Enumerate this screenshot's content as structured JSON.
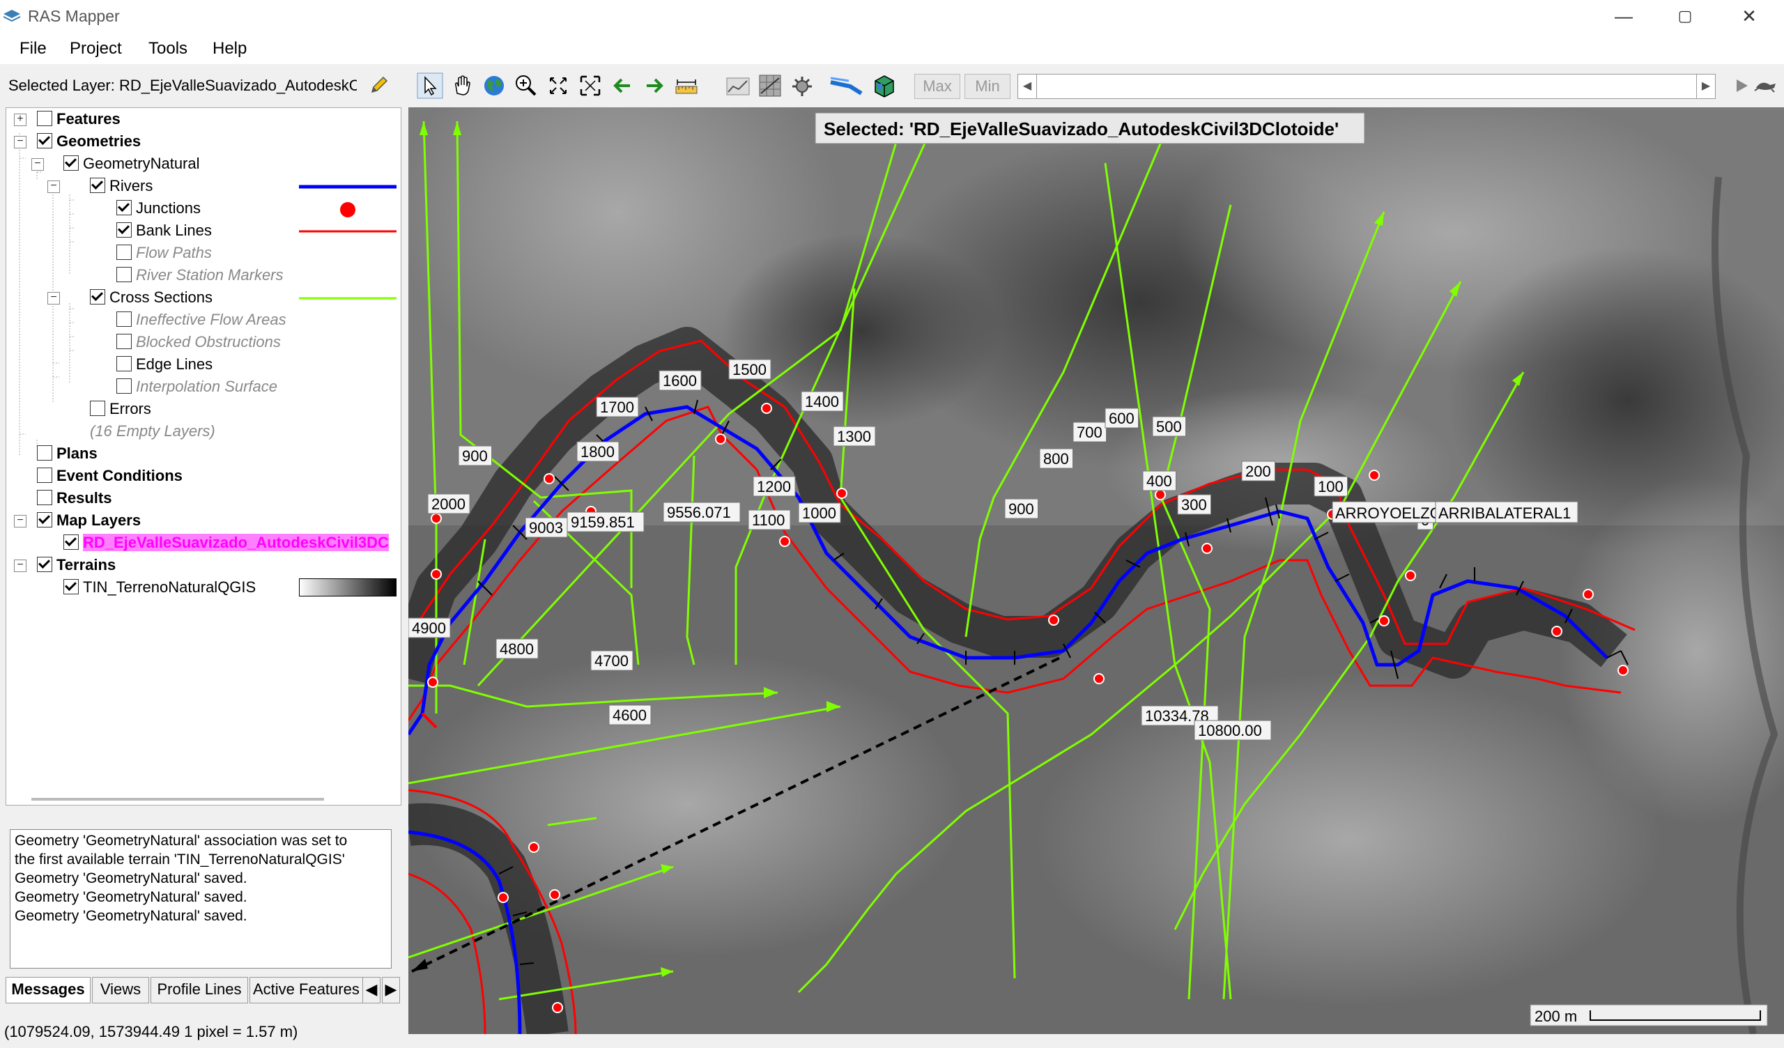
{
  "window": {
    "title": "RAS Mapper",
    "minimize": "—",
    "maximize": "▢",
    "close": "✕"
  },
  "menu": [
    "File",
    "Project",
    "Tools",
    "Help"
  ],
  "selected_layer": "Selected Layer: RD_EjeValleSuavizado_AutodeskC",
  "toolbar": {
    "max": "Max",
    "min": "Min"
  },
  "tree": {
    "features": "Features",
    "geometries": "Geometries",
    "geometry_natural": "GeometryNatural",
    "rivers": "Rivers",
    "junctions": "Junctions",
    "bank_lines": "Bank Lines",
    "flow_paths": "Flow Paths",
    "river_station_markers": "River Station Markers",
    "cross_sections": "Cross Sections",
    "ineffective": "Ineffective Flow Areas",
    "blocked": "Blocked Obstructions",
    "edge_lines": "Edge Lines",
    "interp_surface": "Interpolation Surface",
    "errors": "Errors",
    "empty_layers": "(16 Empty Layers)",
    "plans": "Plans",
    "event_conditions": "Event Conditions",
    "results": "Results",
    "map_layers": "Map Layers",
    "selected_layer_name": "RD_EjeValleSuavizado_AutodeskCivil3DC",
    "terrains": "Terrains",
    "terrain_name": "TIN_TerrenoNaturalQGIS"
  },
  "colors": {
    "river": "#0000ff",
    "junction": "#ff0000",
    "bank": "#ff0000",
    "xs": "#80ff00",
    "highlight": "#ff00ff"
  },
  "messages": [
    "Geometry 'GeometryNatural' association was set to",
    "the first available terrain 'TIN_TerrenoNaturalQGIS'",
    "Geometry 'GeometryNatural' saved.",
    "Geometry 'GeometryNatural' saved.",
    "Geometry 'GeometryNatural' saved."
  ],
  "tabs": [
    "Messages",
    "Views",
    "Profile Lines",
    "Active Features"
  ],
  "status": "(1079524.09, 1573944.49  1 pixel = 1.57 m)",
  "map": {
    "selected_banner": "Selected: 'RD_EjeValleSuavizado_AutodeskCivil3DClotoide'",
    "scale": "200 m",
    "station_labels": [
      "1500",
      "1600",
      "1700",
      "1400",
      "1300",
      "1800",
      "900",
      "1200",
      "1100",
      "1000",
      "900",
      "800",
      "700",
      "600",
      "500",
      "400",
      "300",
      "200",
      "100",
      "0",
      "2000",
      "9003",
      "9159.851",
      "9556.071",
      "4900",
      "4800",
      "4700",
      "4600",
      "10334.78",
      "10800.00"
    ],
    "reach_labels": [
      "ARROYOELZORRO",
      "ARRIBALATERAL1"
    ]
  }
}
